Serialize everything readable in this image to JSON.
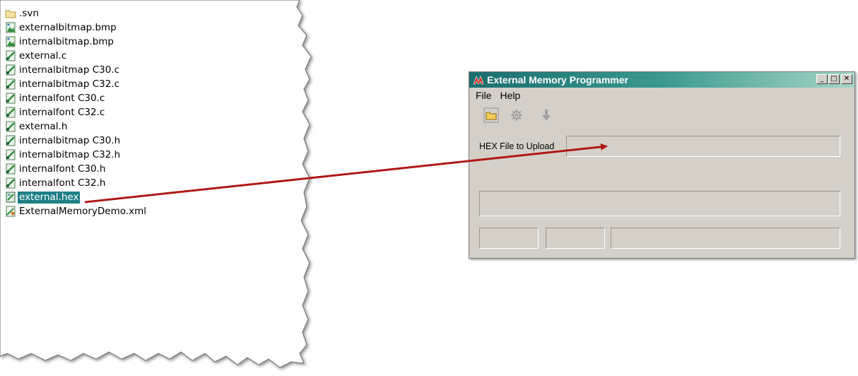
{
  "file_list": [
    {
      "name": ".svn",
      "icon": "folder-icon",
      "selected": false
    },
    {
      "name": "externalbitmap.bmp",
      "icon": "bitmap-file-icon",
      "selected": false
    },
    {
      "name": "internalbitmap.bmp",
      "icon": "bitmap-file-icon",
      "selected": false
    },
    {
      "name": "external.c",
      "icon": "c-source-file-icon",
      "selected": false
    },
    {
      "name": "internalbitmap C30.c",
      "icon": "c-source-file-icon",
      "selected": false
    },
    {
      "name": "internalbitmap C32.c",
      "icon": "c-source-file-icon",
      "selected": false
    },
    {
      "name": "internalfont C30.c",
      "icon": "c-source-file-icon",
      "selected": false
    },
    {
      "name": "internalfont C32.c",
      "icon": "c-source-file-icon",
      "selected": false
    },
    {
      "name": "external.h",
      "icon": "header-file-icon",
      "selected": false
    },
    {
      "name": "internalbitmap C30.h",
      "icon": "header-file-icon",
      "selected": false
    },
    {
      "name": "internalbitmap C32.h",
      "icon": "header-file-icon",
      "selected": false
    },
    {
      "name": "internalfont C30.h",
      "icon": "header-file-icon",
      "selected": false
    },
    {
      "name": "internalfont C32.h",
      "icon": "header-file-icon",
      "selected": false
    },
    {
      "name": "external.hex",
      "icon": "hex-file-icon",
      "selected": true
    },
    {
      "name": "ExternalMemoryDemo.xml",
      "icon": "xml-file-icon",
      "selected": false
    }
  ],
  "window": {
    "title": "External Memory Programmer",
    "controls": {
      "minimize": "_",
      "maximize": "□",
      "close": "✕"
    },
    "menu": [
      "File",
      "Help"
    ],
    "toolbar": [
      "open-folder-icon",
      "settings-gear-icon",
      "download-arrow-icon"
    ],
    "hex_label": "HEX File to Upload",
    "hex_value": ""
  },
  "colors": {
    "selection": "#1f7f87",
    "window_bg": "#d4d0c8",
    "title_gradient_start": "#1a6e6e",
    "arrow": "#b01818"
  }
}
